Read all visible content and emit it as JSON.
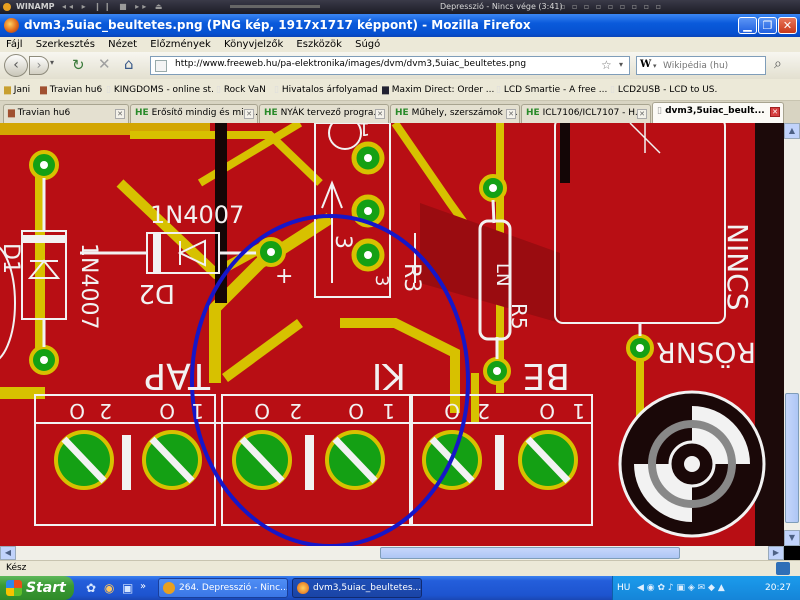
{
  "winamp": {
    "logo": "WINAMP",
    "track": "Depresszió - Nincs vége (3:41)"
  },
  "window": {
    "title": "dvm3,5uiac_beultetes.png (PNG kép, 1917x1717 képpont) - Mozilla Firefox"
  },
  "menu": [
    "Fájl",
    "Szerkesztés",
    "Nézet",
    "Előzmények",
    "Könyvjelzők",
    "Eszközök",
    "Súgó"
  ],
  "address": {
    "url": "http://www.freeweb.hu/pa-elektronika/images/dvm/dvm3,5uiac_beultetes.png"
  },
  "search": {
    "engine_letter": "W",
    "placeholder": "Wikipédia (hu)"
  },
  "bookmarks": [
    "Jani",
    "Travian hu6",
    "KINGDOMS - online st...",
    "Rock VaN",
    "Hivatalos árfolyamad...",
    "Maxim Direct: Order ...",
    "LCD Smartie - A free ...",
    "LCD2USB - LCD to US..."
  ],
  "tabs": [
    {
      "prefix": "",
      "label": "Travian hu6"
    },
    {
      "prefix": "HE",
      "label": "Erősítő mindig és min..."
    },
    {
      "prefix": "HE",
      "label": "NYÁK tervező progra..."
    },
    {
      "prefix": "HE",
      "label": "Műhely, szerszámok -..."
    },
    {
      "prefix": "HE",
      "label": "ICL7106/ICL7107 - H..."
    },
    {
      "prefix": "",
      "label": "dvm3,5uiac_beult..."
    }
  ],
  "pcb": {
    "diode_label": "1N4007",
    "d2": "D2",
    "d1": "D1",
    "mirrored_diode": "1N4007",
    "regulator_pins": [
      "1",
      "3"
    ],
    "reg_pin_bottom": "3",
    "r_label": "R3",
    "r_label2": "R5",
    "ic_text": "LN",
    "nosnr": "NINCS",
    "rosnr": "RÖSNR",
    "tap": "TAP",
    "ki": "KI",
    "be": "BE",
    "pin2": "2",
    "pin1": "1",
    "sub_o": "O",
    "mark": "+"
  },
  "status": {
    "text": "Kész"
  },
  "taskbar": {
    "start": "Start",
    "tasks": [
      "264. Depresszió - Ninc...",
      "dvm3,5uiac_beultetes..."
    ],
    "lang": "HU",
    "clock": "20:27"
  },
  "colors": {
    "board": "#b80e14",
    "copper": "#d7c100",
    "pad": "#14a014",
    "silk": "#f2f2f2",
    "circle": "#1616c8"
  }
}
